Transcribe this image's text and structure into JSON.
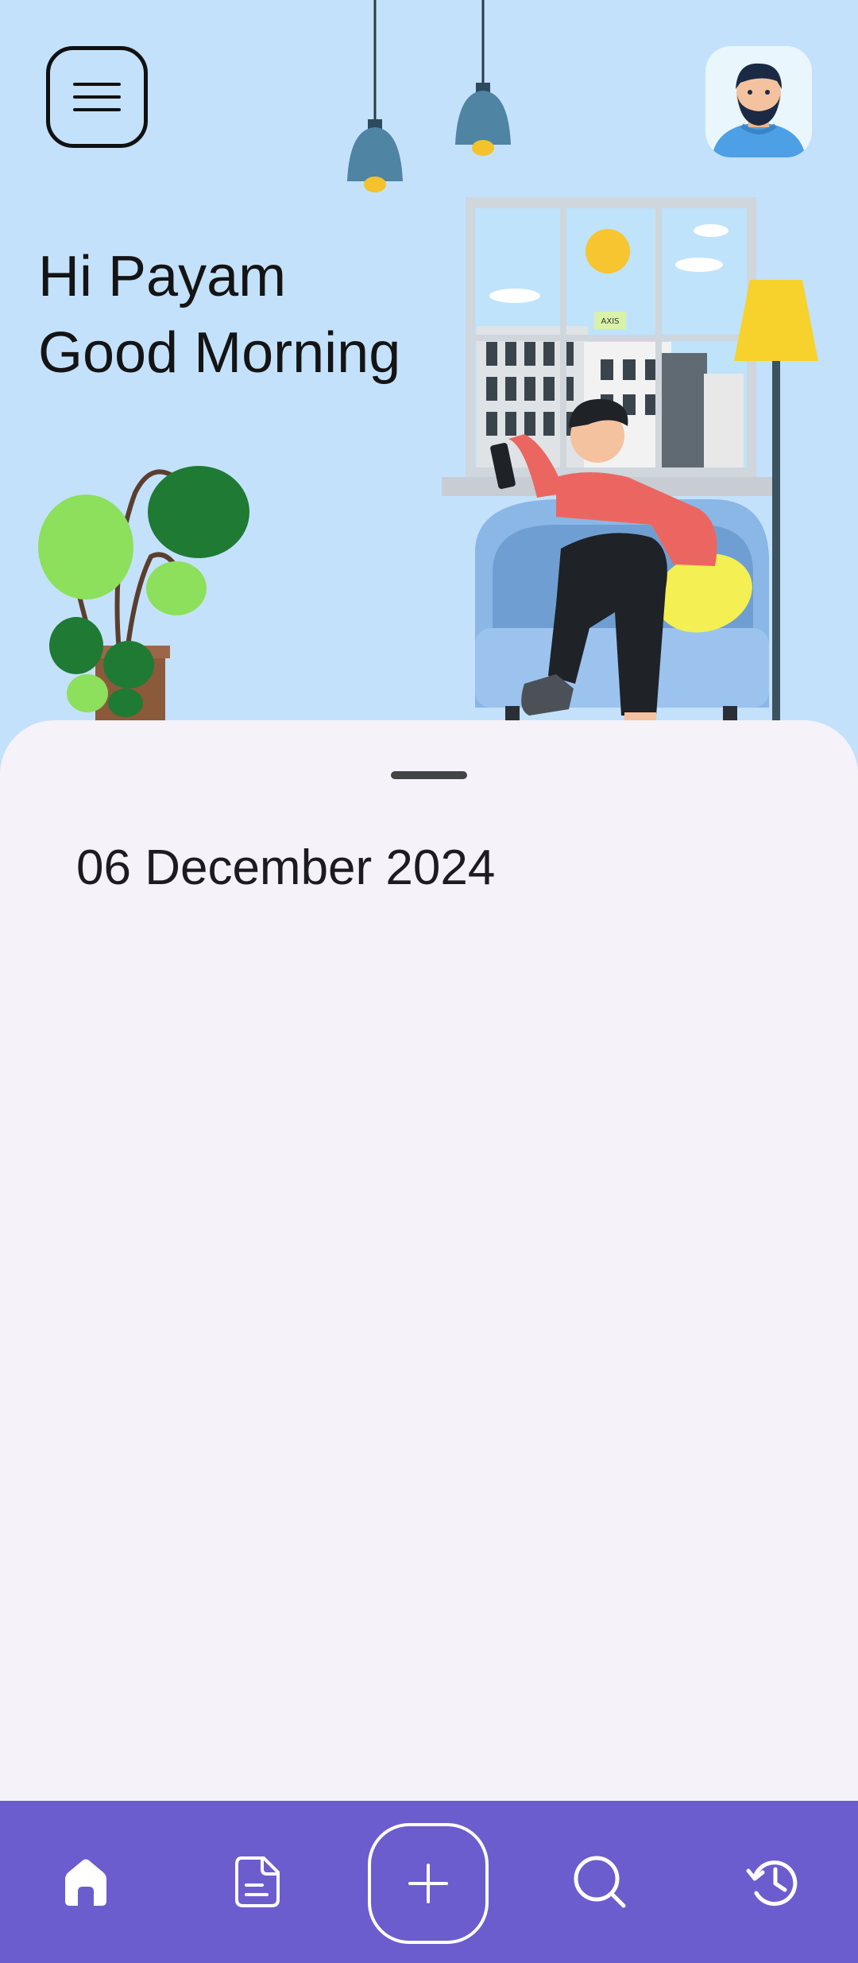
{
  "header": {
    "menu_icon": "hamburger-menu-icon",
    "avatar_icon": "user-avatar"
  },
  "greeting": {
    "line1": "Hi Payam",
    "line2": "Good Morning"
  },
  "illustration": {
    "name": "man-on-armchair-illustration",
    "window_sign": "AXIS"
  },
  "sheet": {
    "date": "06 December 2024"
  },
  "bottom_nav": {
    "items": [
      {
        "icon": "home-icon",
        "active": true
      },
      {
        "icon": "notes-icon",
        "active": false
      },
      {
        "icon": "add-icon",
        "active": false
      },
      {
        "icon": "search-icon",
        "active": false
      },
      {
        "icon": "history-icon",
        "active": false
      }
    ]
  },
  "colors": {
    "hero_bg": "#c4e1fb",
    "sheet_bg": "#f6f2f9",
    "nav_bg": "#6b5dcd",
    "text": "#141414"
  }
}
